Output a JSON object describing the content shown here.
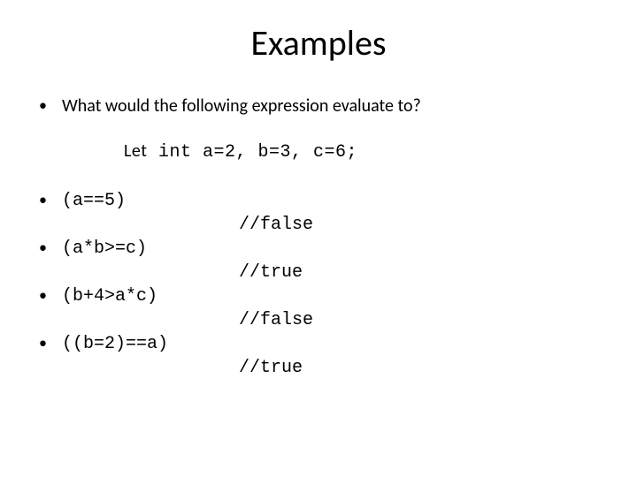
{
  "title": "Examples",
  "intro": "What would the following expression evaluate to?",
  "let_prefix": "Let",
  "let_code": "int  a=2, b=3, c=6;",
  "items": [
    {
      "expr": "(a==5)",
      "result": "//false"
    },
    {
      "expr": "(a*b>=c)",
      "result": "//true"
    },
    {
      "expr": "(b+4>a*c)",
      "result": "//false"
    },
    {
      "expr": "((b=2)==a)",
      "result": "//true"
    }
  ]
}
